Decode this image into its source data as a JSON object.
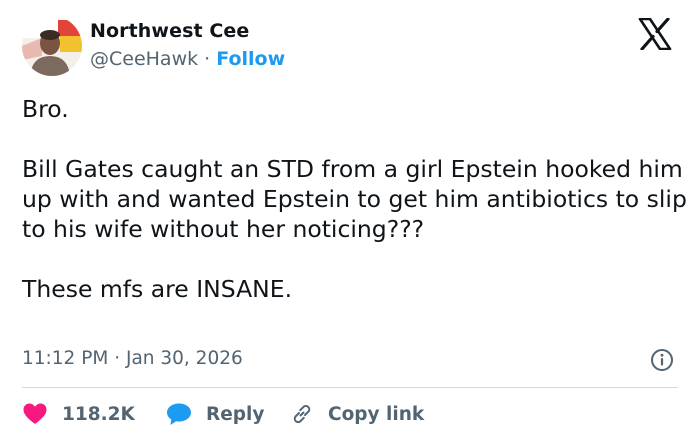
{
  "author": {
    "name": "Northwest Cee",
    "handle": "@CeeHawk",
    "separator": "·",
    "follow_label": "Follow"
  },
  "post": {
    "line1": "Bro.",
    "line2": "Bill Gates caught an STD from a girl Epstein hooked him up with and wanted Epstein to get him antibiotics to slip to his wife without her noticing???",
    "line3": "These mfs are INSANE."
  },
  "meta": {
    "time": "11:12 PM",
    "separator": "·",
    "date": "Jan 30, 2026"
  },
  "actions": {
    "like_count": "118.2K",
    "reply_label": "Reply",
    "copy_link_label": "Copy link"
  },
  "colors": {
    "text": "#0f1419",
    "secondary": "#536471",
    "accent": "#1d9bf0",
    "like": "#f91880",
    "divider": "#cfd9de"
  },
  "icons": {
    "logo": "x-logo-icon",
    "info": "info-icon",
    "like": "heart-icon",
    "reply": "speech-bubble-icon",
    "copy_link": "link-icon"
  }
}
